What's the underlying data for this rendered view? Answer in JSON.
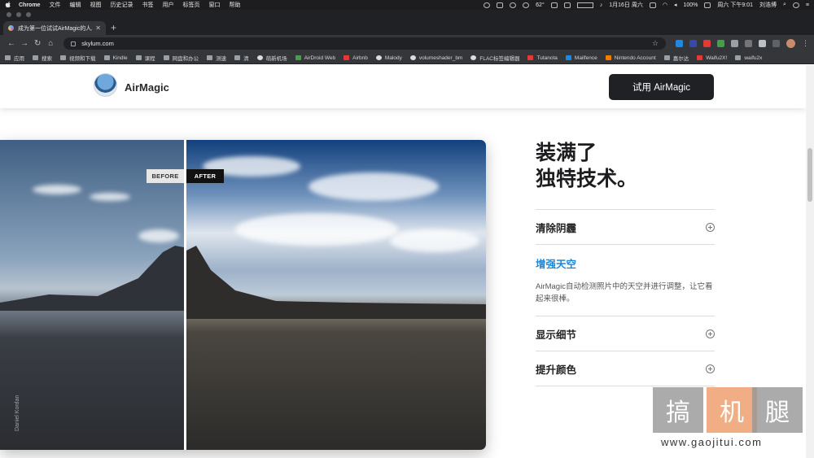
{
  "menubar": {
    "app": "Chrome",
    "items": [
      "文件",
      "编辑",
      "视图",
      "历史记录",
      "书签",
      "用户",
      "标签页",
      "窗口",
      "帮助"
    ],
    "temperature": "62°",
    "battery": "100%",
    "date": "1月16日 周六",
    "clock": "周六 下午9:01",
    "user": "刘浩博"
  },
  "tabs": [
    {
      "title": "成为第一位试试AirMagic的人。"
    }
  ],
  "toolbar": {
    "url": "skylum.com"
  },
  "bookmarks": [
    "应用",
    "搜索",
    "视频和下载",
    "Kindle",
    "课程",
    "网盘和办公",
    "测速",
    "清",
    "萌新机场",
    "AirDroid Web",
    "Airbnb",
    "Malody",
    "volumeshader_bm",
    "FLAC标签编辑器",
    "Tutanota",
    "Mailfence",
    "Nintendo Account",
    "嘉尔达",
    "Waifu2X!",
    "waifu2x"
  ],
  "header": {
    "brand": "AirMagic",
    "cta": "试用 AirMagic"
  },
  "photo": {
    "before_label": "BEFORE",
    "after_label": "AFTER",
    "credit": "Daniel Kordan"
  },
  "features": {
    "headline_line1": "装满了",
    "headline_line2": "独特技术。",
    "items": [
      {
        "title": "清除阴霾"
      },
      {
        "title": "增强天空",
        "description": "AirMagic自动检测照片中的天空并进行调整，让它看起来很棒。"
      },
      {
        "title": "显示细节"
      },
      {
        "title": "提升颜色"
      }
    ]
  },
  "watermark": {
    "chars": [
      "搞",
      "机",
      "腿"
    ],
    "site": "www.gaojitui.com"
  },
  "colors": {
    "accent": "#1e88d6",
    "cta_bg": "#1f2125",
    "browser_dark": "#35363a"
  }
}
